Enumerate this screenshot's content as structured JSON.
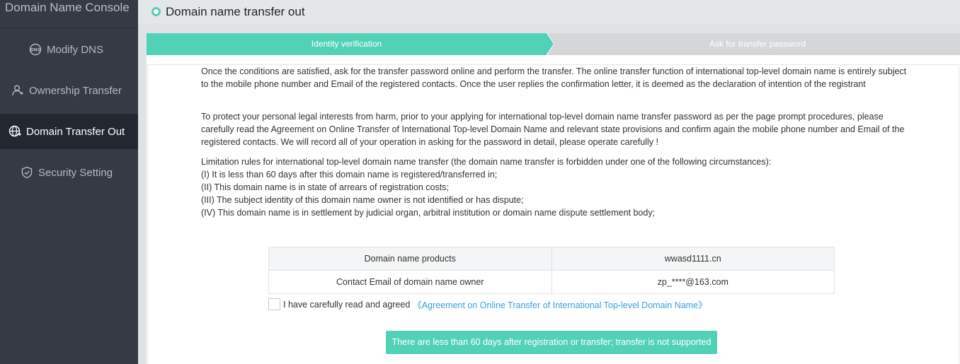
{
  "sidebar": {
    "title": "Domain Name Console",
    "items": [
      {
        "label": "Modify DNS",
        "icon": "dns-icon"
      },
      {
        "label": "Ownership Transfer",
        "icon": "user-transfer-icon"
      },
      {
        "label": "Domain Transfer Out",
        "icon": "globe-icon",
        "active": true
      },
      {
        "label": "Security Setting",
        "icon": "shield-check-icon"
      }
    ]
  },
  "header": {
    "title": "Domain name transfer out"
  },
  "steps": [
    {
      "label": "Identity verification",
      "active": true
    },
    {
      "label": "Ask for transfer password",
      "active": false
    }
  ],
  "content": {
    "paragraph1": "Once the conditions are satisfied, ask for the transfer password online and perform the transfer. The online transfer function of international top-level domain name is entirely subject to the mobile phone number and Email of the registered contacts. Once the user replies the confirmation letter, it is deemed as the declaration of intention of the registrant",
    "paragraph2": "To protect your personal legal interests from harm, prior to your applying for international top-level domain name transfer password as per the page prompt procedures, please carefully read the Agreement on Online Transfer of International Top-level Domain Name and relevant state provisions and confirm again the mobile phone number and Email of the registered contacts. We will record all of your operation in asking for the password in detail, please operate carefully !",
    "limitation_title": "Limitation rules for international top-level domain name transfer (the domain name transfer is forbidden under one of the following circumstances):",
    "rules": [
      "(I) It is less than 60 days after this domain name is registered/transferred in;",
      "(II) This domain name is in state of arrears of registration costs;",
      "(III) The subject identity of this domain name owner is not identified or has dispute;",
      "(IV) This domain name is in settlement by judicial organ, arbitral institution or domain name dispute settlement body;"
    ]
  },
  "table": {
    "rows": [
      {
        "label": "Domain name products",
        "value": "wwasd1111.cn"
      },
      {
        "label": "Contact Email of domain name owner",
        "value": "zp_****@163.com"
      }
    ]
  },
  "agreement": {
    "text": "I have carefully read and agreed",
    "link": "《Agreement on Online Transfer of International Top-level Domain Name》",
    "checked": false
  },
  "submit_button": "There are less than 60 days after registration or transfer; transfer is not supported",
  "colors": {
    "accent": "#52d1b7",
    "sidebar_bg": "#353a45",
    "link": "#3a9fe0"
  }
}
